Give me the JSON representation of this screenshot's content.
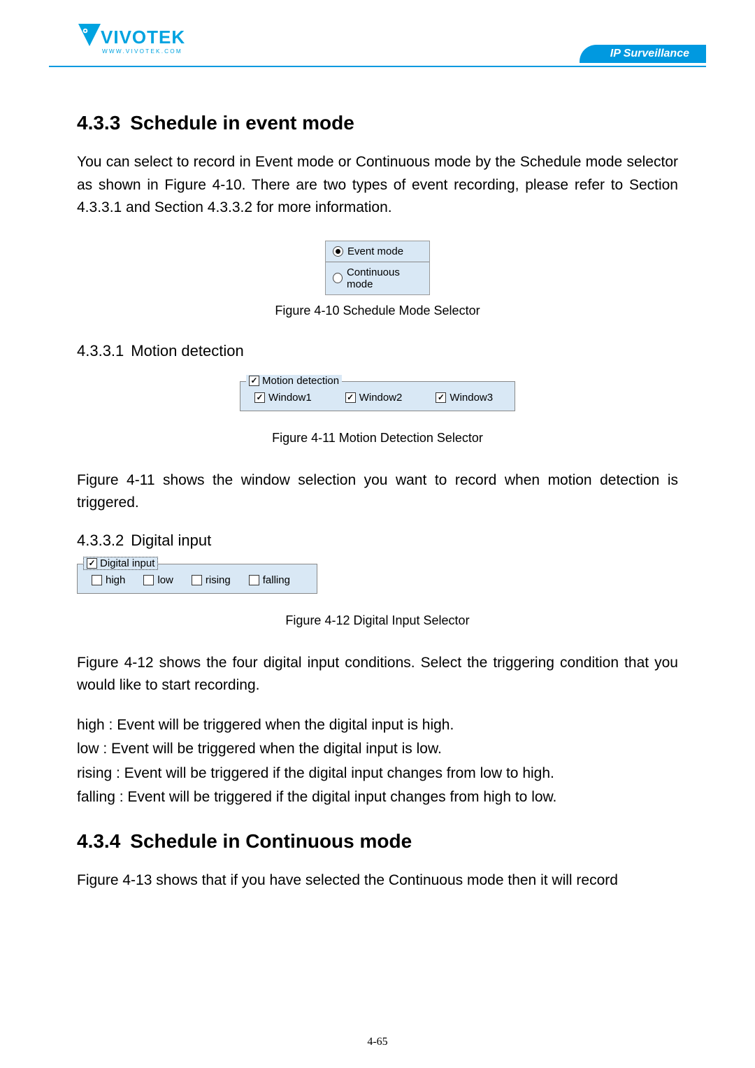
{
  "header": {
    "brand": "VIVOTEK",
    "brand_sub": "www.vivotek.com",
    "tagline": "IP Surveillance"
  },
  "section433": {
    "number": "4.3.3",
    "title": "Schedule in event mode",
    "intro": "You can select to record in Event mode or Continuous mode by the Schedule mode selector as shown in Figure 4-10. There are two types of event recording, please refer to Section 4.3.3.1 and Section 4.3.3.2 for more information."
  },
  "figure410": {
    "mode_options": {
      "event": "Event mode",
      "continuous": "Continuous mode"
    },
    "caption": "Figure 4-10 Schedule Mode Selector"
  },
  "section4331": {
    "number": "4.3.3.1",
    "title": "Motion detection"
  },
  "figure411": {
    "group_label": "Motion detection",
    "windows": {
      "w1": "Window1",
      "w2": "Window2",
      "w3": "Window3"
    },
    "caption": "Figure 4-11 Motion Detection Selector",
    "desc": "Figure 4-11 shows the window selection you want to record when motion detection is triggered."
  },
  "section4332": {
    "number": "4.3.3.2",
    "title": "Digital input"
  },
  "figure412": {
    "group_label": "Digital input",
    "opts": {
      "high": "high",
      "low": "low",
      "rising": "rising",
      "falling": "falling"
    },
    "caption": "Figure 4-12 Digital Input Selector",
    "desc": "Figure 4-12 shows the four digital input conditions. Select the triggering condition that you would like to start recording.",
    "bullets": {
      "high": "high : Event will be triggered when the digital input is high.",
      "low": "low : Event will be triggered when the digital input is low.",
      "rising": "rising : Event will be triggered if the digital input changes from low to high.",
      "falling": "falling : Event will be triggered if the digital input changes from high to low."
    }
  },
  "section434": {
    "number": "4.3.4",
    "title": "Schedule in Continuous mode",
    "intro": "Figure 4-13 shows that if you have selected the Continuous mode then it will record"
  },
  "pagenum": "4-65"
}
